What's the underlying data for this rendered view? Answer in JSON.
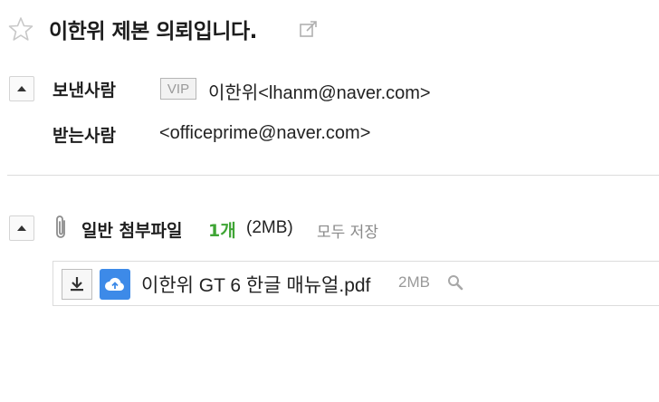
{
  "mail": {
    "subject": "이한위 제본 의뢰입니다.",
    "from_label": "보낸사람",
    "vip_badge": "VIP",
    "from_address": "이한위<lhanm@naver.com>",
    "to_label": "받는사람",
    "to_address": "<officeprime@naver.com>"
  },
  "attachments": {
    "title": "일반 첨부파일",
    "count": "1개",
    "total_size": "(2MB)",
    "save_all_label": "모두 저장",
    "files": [
      {
        "name": "이한위 GT 6 한글 매뉴얼.pdf",
        "size": "2MB"
      }
    ]
  },
  "icons": {
    "star": "star-outline-icon",
    "popout": "open-new-window-icon",
    "toggle": "collapse-triangle-icon",
    "clip": "paperclip-icon",
    "download": "download-icon",
    "cloud": "cloud-save-icon",
    "magnify": "preview-magnifier-icon"
  },
  "colors": {
    "count_green": "#3fa535",
    "cloud_blue": "#3d8ae8"
  }
}
